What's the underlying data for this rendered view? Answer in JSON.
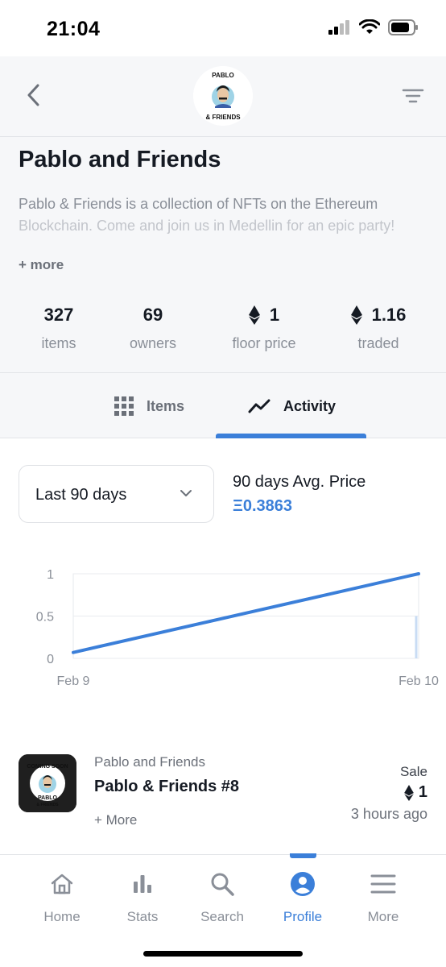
{
  "status_bar": {
    "time": "21:04"
  },
  "header": {
    "logo_text_top": "PABLO",
    "logo_text_bottom": "& FRIENDS"
  },
  "collection": {
    "title": "Pablo and Friends",
    "description_line1": "Pablo & Friends is a collection of NFTs on the Ethereum",
    "description_line2": "Blockchain. Come and join us in Medellin for an epic party!",
    "more_label": "+ more"
  },
  "stats": [
    {
      "value": "327",
      "label": "items",
      "icon": "none"
    },
    {
      "value": "69",
      "label": "owners",
      "icon": "none"
    },
    {
      "value": "1",
      "label": "floor price",
      "icon": "ethereum-icon"
    },
    {
      "value": "1.16",
      "label": "traded",
      "icon": "ethereum-icon"
    }
  ],
  "tabs": {
    "items_label": "Items",
    "activity_label": "Activity",
    "active": "Activity"
  },
  "activity_filter": {
    "range_selected": "Last 90 days",
    "avg_label": "90 days Avg. Price",
    "avg_value": "Ξ0.3863"
  },
  "chart_data": {
    "type": "line",
    "x": [
      "Feb 9",
      "Feb 10"
    ],
    "series": [
      {
        "values": [
          0.07,
          1.0
        ]
      }
    ],
    "ylim": [
      0,
      1
    ],
    "yticks": [
      "1",
      "0.5",
      "0"
    ],
    "xticks": [
      "Feb 9",
      "Feb 10"
    ],
    "grid": true,
    "color": "#3b7fd9"
  },
  "activity_list": [
    {
      "thumb_text_top": "COMING SOON",
      "thumb_text_bottom_1": "PABLO",
      "thumb_text_bottom_2": "& FRIENDS",
      "collection": "Pablo and Friends",
      "name": "Pablo & Friends #8",
      "more": "+ More",
      "type": "Sale",
      "price": "1",
      "time": "3 hours ago"
    }
  ],
  "bottom_nav": [
    {
      "label": "Home",
      "icon": "home-icon",
      "active": false
    },
    {
      "label": "Stats",
      "icon": "stats-icon",
      "active": false
    },
    {
      "label": "Search",
      "icon": "search-icon",
      "active": false
    },
    {
      "label": "Profile",
      "icon": "profile-icon",
      "active": true
    },
    {
      "label": "More",
      "icon": "menu-icon",
      "active": false
    }
  ],
  "colors": {
    "accent": "#3b7fd9",
    "text_primary": "#151a23",
    "text_secondary": "#8a8f98",
    "section_bg": "#f6f7f9"
  }
}
